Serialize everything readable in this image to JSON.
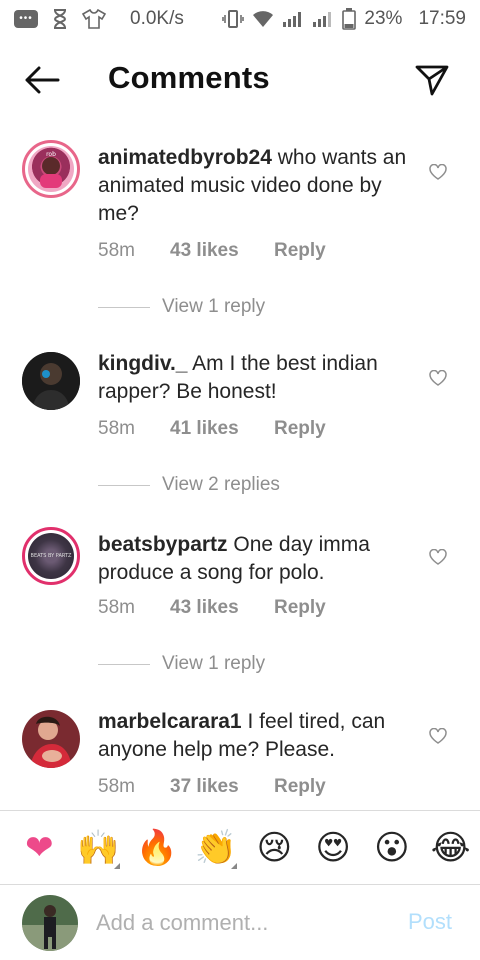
{
  "status_bar": {
    "speed": "0.0K/s",
    "battery": "23%",
    "time": "17:59"
  },
  "header": {
    "title": "Comments"
  },
  "comments": [
    {
      "username": "animatedbyrob24",
      "text": "who wants an animated music video done by me?",
      "time": "58m",
      "likes": "43 likes",
      "reply": "Reply",
      "view_replies": "View 1 reply"
    },
    {
      "username": "kingdiv._",
      "text": "Am I the best indian rapper? Be honest!",
      "time": "58m",
      "likes": "41 likes",
      "reply": "Reply",
      "view_replies": "View 2 replies"
    },
    {
      "username": "beatsbypartz",
      "text": "One day imma produce a song for polo.",
      "time": "58m",
      "likes": "43 likes",
      "reply": "Reply",
      "view_replies": "View 1 reply",
      "avatar_text": "BEATS BY PARTZ"
    },
    {
      "username": "marbelcarara1",
      "text": "I feel tired, can anyone help me? Please.",
      "time": "58m",
      "likes": "37 likes",
      "reply": "Reply"
    }
  ],
  "emoji_bar": {
    "items": [
      {
        "name": "heart-emoji",
        "glyph": "❤"
      },
      {
        "name": "raising-hands-emoji",
        "glyph": "🙌"
      },
      {
        "name": "fire-emoji",
        "glyph": "🔥"
      },
      {
        "name": "clapping-hands-emoji",
        "glyph": "👏"
      },
      {
        "name": "sad-face-emoji",
        "glyph": "😢"
      },
      {
        "name": "heart-eyes-emoji",
        "glyph": "😍"
      },
      {
        "name": "surprised-face-emoji",
        "glyph": "😮"
      },
      {
        "name": "laughing-face-emoji",
        "glyph": "😂"
      }
    ]
  },
  "input": {
    "placeholder": "Add a comment...",
    "value": "",
    "post_label": "Post"
  },
  "colors": {
    "accent": "#e1306c",
    "post_disabled": "#b2dffc",
    "muted": "#8e8e8e"
  }
}
